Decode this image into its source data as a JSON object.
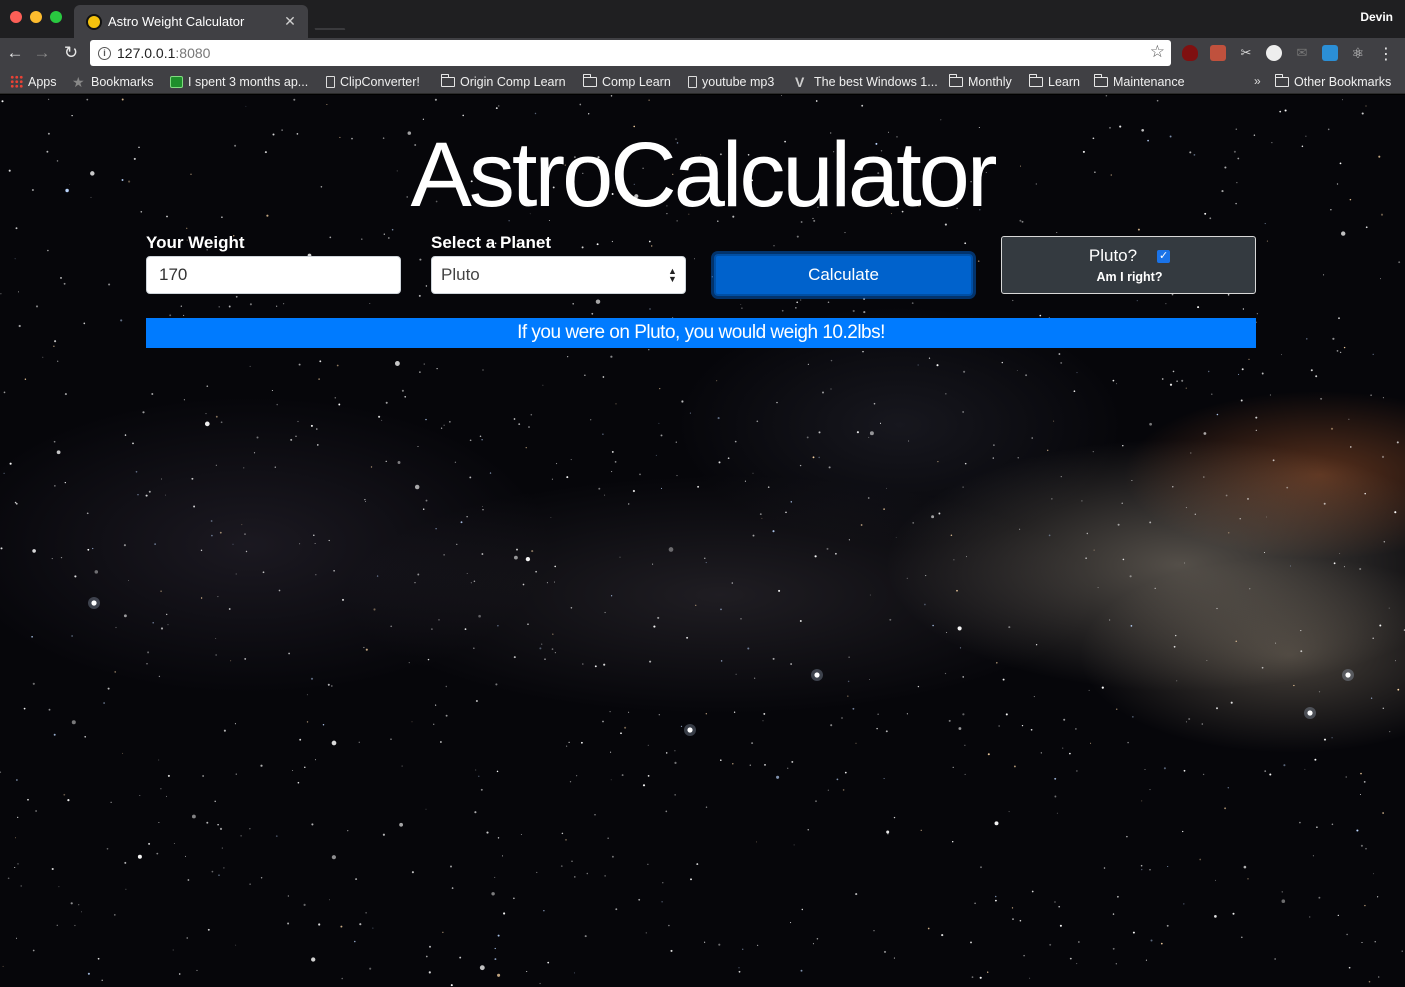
{
  "browser": {
    "tab_title": "Astro Weight Calculator",
    "profile_name": "Devin",
    "url_host": "127.0.0.1",
    "url_port": ":8080"
  },
  "bookmarks": [
    {
      "label": "Apps",
      "icon": "apps-grid-icon"
    },
    {
      "label": "Bookmarks",
      "icon": "star-icon"
    },
    {
      "label": "I spent 3 months ap...",
      "icon": "green-site-icon"
    },
    {
      "label": "ClipConverter!",
      "icon": "page-icon"
    },
    {
      "label": "Origin Comp Learn",
      "icon": "folder-icon"
    },
    {
      "label": "Comp Learn",
      "icon": "folder-icon"
    },
    {
      "label": "youtube mp3",
      "icon": "page-icon"
    },
    {
      "label": "The best Windows 1...",
      "icon": "v-site-icon"
    },
    {
      "label": "Monthly",
      "icon": "folder-icon"
    },
    {
      "label": "Learn",
      "icon": "folder-icon"
    },
    {
      "label": "Maintenance",
      "icon": "folder-icon"
    },
    {
      "label": "Other Bookmarks",
      "icon": "folder-icon"
    }
  ],
  "app": {
    "title": "AstroCalculator",
    "weight_label": "Your Weight",
    "weight_value": "170",
    "planet_label": "Select a Planet",
    "planet_selected": "Pluto",
    "calculate_label": "Calculate",
    "pluto_question": "Pluto?",
    "pluto_checked": true,
    "pluto_subtext": "Am I right?",
    "result": "If you were on Pluto, you would weigh 10.2lbs!"
  },
  "colors": {
    "accent": "#007bff",
    "button": "#0062cc",
    "pluto_box": "#343a40"
  }
}
